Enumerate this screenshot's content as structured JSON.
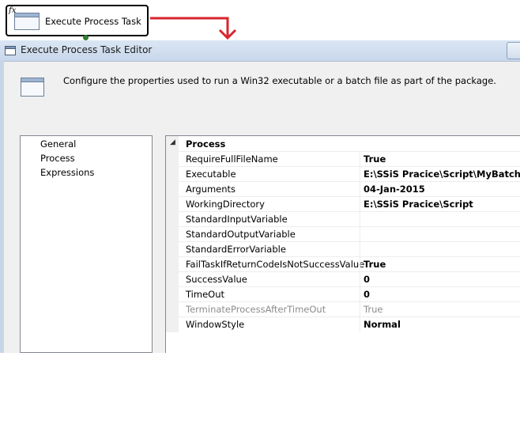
{
  "task_box": {
    "fx_label": "fx",
    "label": "Execute Process Task"
  },
  "window": {
    "title": "Execute Process Task Editor"
  },
  "header": {
    "description": "Configure the properties used to run a Win32 executable or a batch file as part of the package."
  },
  "nav": {
    "items": [
      {
        "label": "General"
      },
      {
        "label": "Process"
      },
      {
        "label": "Expressions"
      }
    ]
  },
  "grid": {
    "category": "Process",
    "toggle_glyph": "◢",
    "rows": [
      {
        "name": "RequireFullFileName",
        "value": "True",
        "disabled": false
      },
      {
        "name": "Executable",
        "value": "E:\\SSiS Pracice\\Script\\MyBatch.bat",
        "disabled": false
      },
      {
        "name": "Arguments",
        "value": "04-Jan-2015",
        "disabled": false
      },
      {
        "name": "WorkingDirectory",
        "value": "E:\\SSiS Pracice\\Script",
        "disabled": false
      },
      {
        "name": "StandardInputVariable",
        "value": "",
        "disabled": false
      },
      {
        "name": "StandardOutputVariable",
        "value": "",
        "disabled": false
      },
      {
        "name": "StandardErrorVariable",
        "value": "",
        "disabled": false
      },
      {
        "name": "FailTaskIfReturnCodeIsNotSuccessValue",
        "value": "True",
        "disabled": false
      },
      {
        "name": "SuccessValue",
        "value": "0",
        "disabled": false
      },
      {
        "name": "TimeOut",
        "value": "0",
        "disabled": false
      },
      {
        "name": "TerminateProcessAfterTimeOut",
        "value": "True",
        "disabled": true
      },
      {
        "name": "WindowStyle",
        "value": "Normal",
        "disabled": false
      }
    ]
  },
  "colors": {
    "arrow": "#d8262c",
    "titlebar": "#c7d7ea",
    "dialog_bg": "#f0f0f0"
  }
}
